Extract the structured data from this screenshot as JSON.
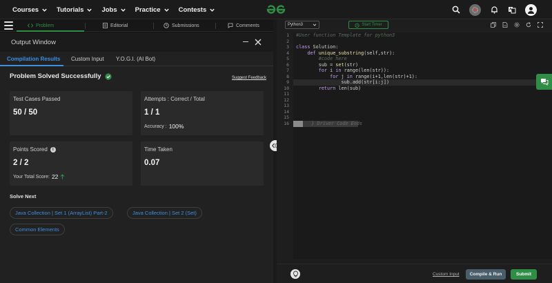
{
  "nav": {
    "items": [
      {
        "label": "Courses"
      },
      {
        "label": "Tutorials"
      },
      {
        "label": "Jobs"
      },
      {
        "label": "Practice"
      },
      {
        "label": "Contests"
      }
    ],
    "logo_icon": "gfg-logo-icon",
    "right_icons": [
      "search-icon",
      "record-icon",
      "bell-icon",
      "translate-icon",
      "user-avatar-icon"
    ]
  },
  "left_tabs": {
    "problem": "Problem",
    "editorial": "Editorial",
    "submissions": "Submissions",
    "comments": "Comments"
  },
  "output": {
    "title": "Output Window",
    "tabs": {
      "compilation": "Compilation Results",
      "custom_input": "Custom Input",
      "yogi": "Y.O.G.I. (AI Bot)"
    },
    "status": "Problem Solved Successfully",
    "feedback": "Suggest Feedback",
    "cards": {
      "test_cases": {
        "label": "Test Cases Passed",
        "value": "50 / 50"
      },
      "attempts": {
        "label": "Attempts : Correct / Total",
        "value": "1 / 1",
        "sub_label": "Accuracy :",
        "sub_value": "100%"
      },
      "points": {
        "label": "Points Scored",
        "value": "2 / 2",
        "sub_label": "Your Total Score:",
        "sub_value": "22"
      },
      "time": {
        "label": "Time Taken",
        "value": "0.07"
      }
    },
    "solve_next": {
      "title": "Solve Next",
      "items": [
        "Java Collection | Set 1 (ArrayList) Part-2",
        "Java Collection | Set 2 (Set)",
        "Common Elements"
      ]
    }
  },
  "editor": {
    "language": "Python3",
    "timer": "Start Timer",
    "line_numbers": [
      "1",
      "2",
      "3",
      "4",
      "5",
      "6",
      "7",
      "8",
      "9",
      "10",
      "11",
      "12",
      "13",
      "14",
      "15",
      "16"
    ],
    "lines": {
      "l1": "#User function Template for python3",
      "l3_kw": "class",
      "l3_rest": " Solution:",
      "l4_kw": "    def",
      "l4_fn": " unique_substring",
      "l4_rest": "(self,str):",
      "l5": "        #code here",
      "l6_a": "        sub = ",
      "l6_fn": "set",
      "l6_b": "(str)",
      "l7_kw": "        for",
      "l7_a": " i ",
      "l7_kw2": "in",
      "l7_b": " range(len(str)):",
      "l8_kw": "            for",
      "l8_a": " j ",
      "l8_kw2": "in",
      "l8_b": " range(i+1,len(str)+1):",
      "l9": "                sub.add(str[i:j])",
      "l10_kw": "        return",
      "l10_rest": " len(sub)",
      "l16": "    } Driver Code Ends"
    },
    "custom_input": "Custom Input",
    "compile": "Compile & Run",
    "submit": "Submit"
  }
}
